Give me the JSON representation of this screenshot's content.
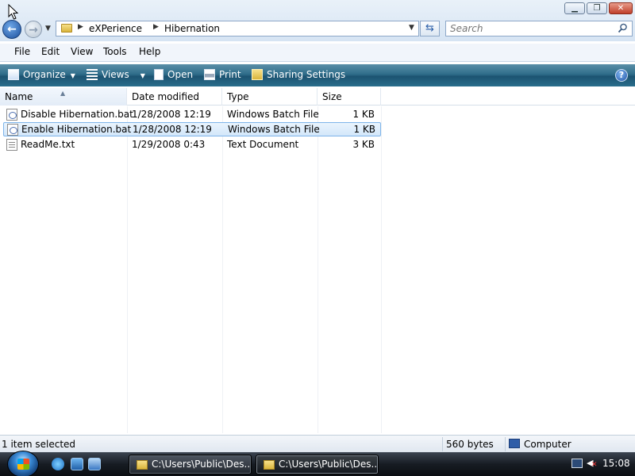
{
  "window": {
    "min_label": "▁",
    "max_label": "❐",
    "close_label": "✕"
  },
  "nav": {
    "back_glyph": "←",
    "fwd_glyph": "→",
    "dropdown_glyph": "▼"
  },
  "address": {
    "crumbs": [
      "eXPerience",
      "Hibernation"
    ],
    "refresh_glyph": "⇆"
  },
  "search": {
    "placeholder": "Search"
  },
  "menu": {
    "items": [
      "File",
      "Edit",
      "View",
      "Tools",
      "Help"
    ]
  },
  "commands": {
    "organize": "Organize",
    "views": "Views",
    "open": "Open",
    "print": "Print",
    "sharing": "Sharing Settings",
    "help_glyph": "?"
  },
  "columns": {
    "name": "Name",
    "date": "Date modified",
    "type": "Type",
    "size": "Size"
  },
  "files": [
    {
      "name": "Disable Hibernation.bat",
      "date": "1/28/2008 12:19",
      "type": "Windows Batch File",
      "size": "1 KB",
      "icon": "batch-file-icon",
      "selected": false
    },
    {
      "name": "Enable Hibernation.bat",
      "date": "1/28/2008 12:19",
      "type": "Windows Batch File",
      "size": "1 KB",
      "icon": "batch-file-icon",
      "selected": true
    },
    {
      "name": "ReadMe.txt",
      "date": "1/29/2008 0:43",
      "type": "Text Document",
      "size": "3 KB",
      "icon": "text-file-icon",
      "selected": false
    }
  ],
  "status": {
    "selection": "1 item selected",
    "size": "560 bytes",
    "zone": "Computer"
  },
  "taskbar": {
    "tasks": [
      "C:\\Users\\Public\\Des...",
      "C:\\Users\\Public\\Des..."
    ],
    "clock": "15:08"
  }
}
